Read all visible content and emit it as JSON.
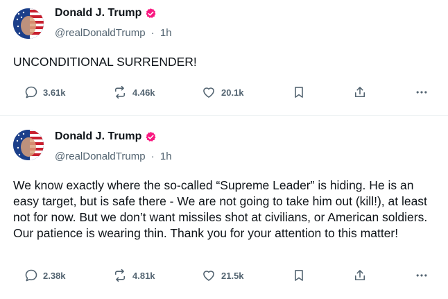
{
  "colors": {
    "text": "#0f1419",
    "muted": "#536471",
    "verified": "#f91880",
    "divider": "#eff3f4"
  },
  "posts": [
    {
      "author": "Donald J. Trump",
      "handle": "@realDonaldTrump",
      "separator": "·",
      "time": "1h",
      "text": "UNCONDITIONAL SURRENDER!",
      "stats": {
        "replies": "3.61k",
        "reposts": "4.46k",
        "likes": "20.1k"
      },
      "icons": [
        "reply-icon",
        "repost-icon",
        "heart-icon",
        "bookmark-icon",
        "share-icon",
        "more-icon"
      ]
    },
    {
      "author": "Donald J. Trump",
      "handle": "@realDonaldTrump",
      "separator": "·",
      "time": "1h",
      "text": "We know exactly where the so-called “Supreme Leader” is hiding. He is an easy target, but is safe there - We are not going to take him out (kill!), at least not for now. But we don’t want missiles shot at civilians, or American soldiers. Our patience is wearing thin. Thank you for your attention to this matter!",
      "stats": {
        "replies": "2.38k",
        "reposts": "4.81k",
        "likes": "21.5k"
      },
      "icons": [
        "reply-icon",
        "repost-icon",
        "heart-icon",
        "bookmark-icon",
        "share-icon",
        "more-icon"
      ]
    }
  ]
}
